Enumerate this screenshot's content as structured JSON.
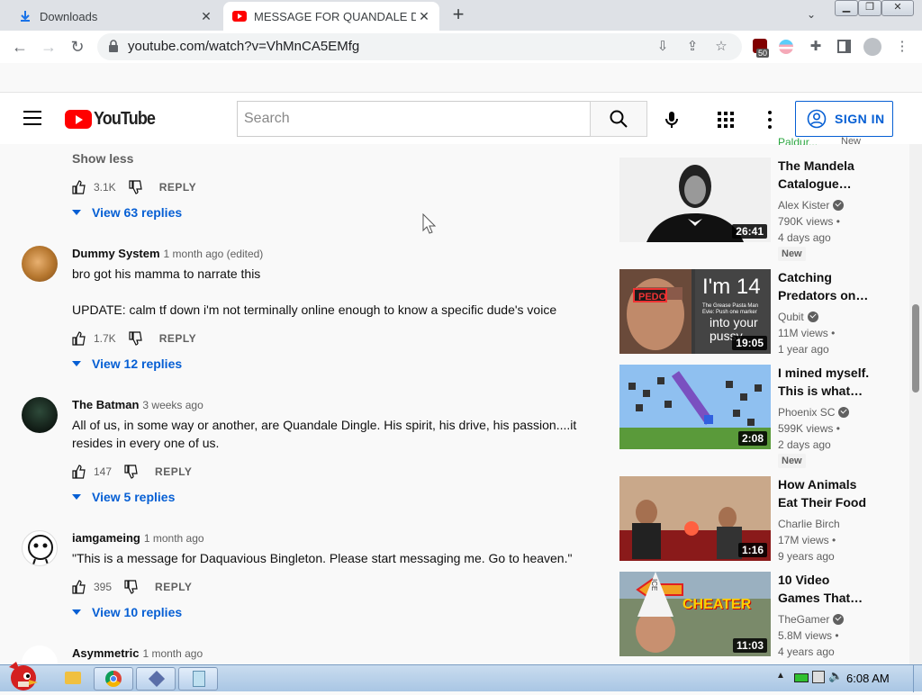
{
  "browser": {
    "tabs": [
      {
        "label": "Downloads",
        "active": false
      },
      {
        "label": "MESSAGE FOR QUANDALE DI",
        "active": true
      }
    ],
    "url": "youtube.com/watch?v=VhMnCA5EMfg",
    "extension_badge": "50"
  },
  "header": {
    "logo_text": "YouTube",
    "search_placeholder": "Search",
    "signin_label": "SIGN IN"
  },
  "comments": {
    "show_less": "Show less",
    "first_actions": {
      "likes": "3.1K",
      "reply_label": "REPLY",
      "view_replies": "View 63 replies"
    },
    "items": [
      {
        "author": "Dummy System",
        "ago": "1 month ago (edited)",
        "text": [
          "bro got his mamma to narrate this",
          "",
          "UPDATE: calm tf down i'm not terminally online enough to know a specific dude's voice"
        ],
        "likes": "1.7K",
        "reply_label": "REPLY",
        "view_replies": "View 12 replies"
      },
      {
        "author": "The Batman",
        "ago": "3 weeks ago",
        "text": [
          "All of us, in some way or another, are Quandale Dingle.  His spirit, his drive, his passion....it resides in every one of us."
        ],
        "likes": "147",
        "reply_label": "REPLY",
        "view_replies": "View 5 replies"
      },
      {
        "author": "iamgameing",
        "ago": "1 month ago",
        "text": [
          "\"This is a message for Daquavious Bingleton. Please start messaging me. Go to heaven.\""
        ],
        "likes": "395",
        "reply_label": "REPLY",
        "view_replies": "View 10 replies"
      },
      {
        "author": "Asymmetric",
        "ago": "1 month ago"
      }
    ]
  },
  "sidebar": {
    "partial_top": [
      "Paldur...",
      "New"
    ],
    "videos": [
      {
        "title_lines": [
          "The Mandela",
          "Catalogue…"
        ],
        "channel": "Alex Kister",
        "verified": true,
        "views": "790K views",
        "age": "4 days ago",
        "badge": "New",
        "duration": "26:41"
      },
      {
        "title_lines": [
          "Catching",
          "Predators on…"
        ],
        "channel": "Qubit",
        "verified": true,
        "views": "11M views",
        "age": "1 year ago",
        "badge": "",
        "duration": "19:05",
        "thumb_text": [
          "PEDO",
          "I'm 14",
          "The Grease Pasta Man",
          "Evie: Push one marker",
          "into your",
          "pussy"
        ]
      },
      {
        "title_lines": [
          "I mined myself.",
          "This is what…"
        ],
        "channel": "Phoenix SC",
        "verified": true,
        "views": "599K views",
        "age": "2 days ago",
        "badge": "New",
        "duration": "2:08"
      },
      {
        "title_lines": [
          "How Animals",
          "Eat Their Food"
        ],
        "channel": "Charlie Birch",
        "verified": false,
        "views": "17M views",
        "age": "9 years ago",
        "badge": "",
        "duration": "1:16"
      },
      {
        "title_lines": [
          "10 Video",
          "Games That…"
        ],
        "channel": "TheGamer",
        "verified": true,
        "views": "5.8M views",
        "age": "4 years ago",
        "badge": "",
        "duration": "11:03",
        "thumb_text": [
          "CHEATER",
          "ICE"
        ]
      }
    ]
  },
  "taskbar": {
    "clock": "6:08 AM"
  }
}
